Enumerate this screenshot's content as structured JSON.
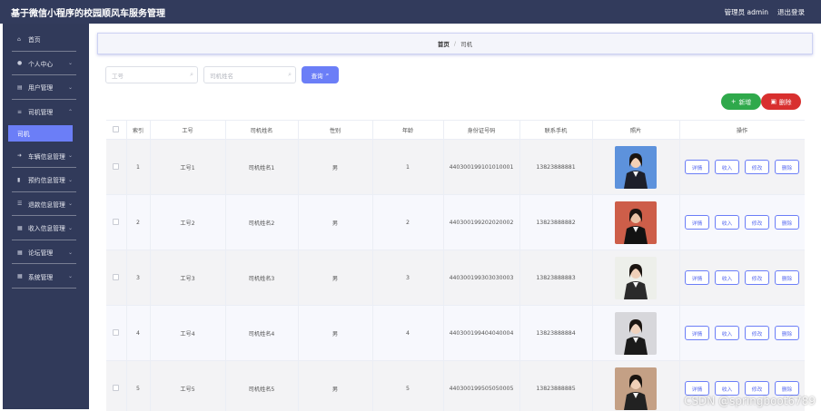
{
  "header": {
    "title": "基于微信小程序的校园顺风车服务管理",
    "admin_label": "管理员 admin",
    "logout_label": "退出登录"
  },
  "sidebar": {
    "items": [
      {
        "label": "首页",
        "icon": "home-icon",
        "has_children": false
      },
      {
        "label": "个人中心",
        "icon": "user-icon",
        "has_children": true
      },
      {
        "label": "用户管理",
        "icon": "list-icon",
        "has_children": true
      },
      {
        "label": "司机管理",
        "icon": "menu-icon",
        "has_children": true
      },
      {
        "label": "司机",
        "icon": "",
        "has_children": false,
        "active": true
      },
      {
        "label": "车辆信息管理",
        "icon": "car-icon",
        "has_children": true
      },
      {
        "label": "预约信息管理",
        "icon": "chart-icon",
        "has_children": true
      },
      {
        "label": "退款信息管理",
        "icon": "sort-icon",
        "has_children": true
      },
      {
        "label": "收入信息管理",
        "icon": "grid-icon",
        "has_children": true
      },
      {
        "label": "论坛管理",
        "icon": "grid-icon",
        "has_children": true
      },
      {
        "label": "系统管理",
        "icon": "grid-icon",
        "has_children": true
      }
    ]
  },
  "breadcrumb": {
    "home": "首页",
    "separator": "/",
    "current": "司机"
  },
  "search": {
    "field1_placeholder": "工号",
    "field2_placeholder": "司机姓名",
    "button_label": "查询"
  },
  "actions": {
    "add_label": "新增",
    "delete_label": "删除"
  },
  "table": {
    "columns": [
      "索引",
      "工号",
      "司机姓名",
      "性别",
      "年龄",
      "身份证号码",
      "联系手机",
      "照片",
      "操作"
    ],
    "rows": [
      {
        "index": "1",
        "id": "工号1",
        "name": "司机姓名1",
        "gender": "男",
        "age": "1",
        "idcard": "440300199101010001",
        "phone": "13823888881"
      },
      {
        "index": "2",
        "id": "工号2",
        "name": "司机姓名2",
        "gender": "男",
        "age": "2",
        "idcard": "440300199202020002",
        "phone": "13823888882"
      },
      {
        "index": "3",
        "id": "工号3",
        "name": "司机姓名3",
        "gender": "男",
        "age": "3",
        "idcard": "440300199303030003",
        "phone": "13823888883"
      },
      {
        "index": "4",
        "id": "工号4",
        "name": "司机姓名4",
        "gender": "男",
        "age": "4",
        "idcard": "440300199404040004",
        "phone": "13823888884"
      },
      {
        "index": "5",
        "id": "工号5",
        "name": "司机姓名5",
        "gender": "男",
        "age": "5",
        "idcard": "440300199505050005",
        "phone": "13823888885"
      }
    ],
    "op_labels": [
      "详情",
      "收入",
      "修改",
      "删除"
    ]
  },
  "watermark": "CSDN @springboot6789",
  "colors": {
    "sidebar_bg": "#313a5a",
    "header_bg": "#323b5c",
    "accent": "#6b7ef7",
    "add_green": "#2fa94b",
    "delete_red": "#d8302f"
  }
}
